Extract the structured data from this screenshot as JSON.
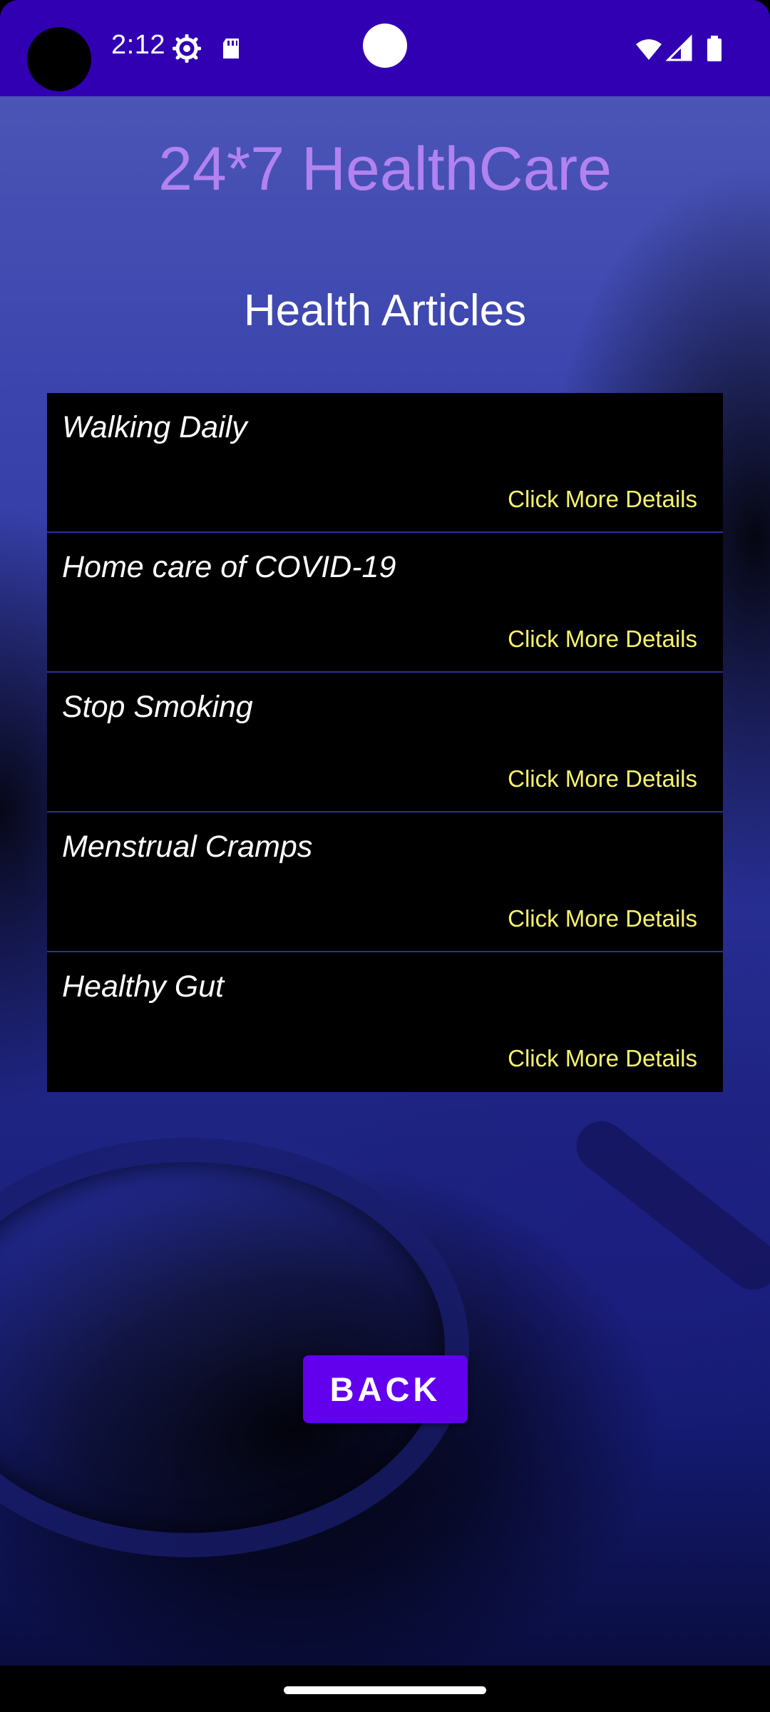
{
  "status_bar": {
    "time": "2:12",
    "icons": [
      "gear-icon",
      "sd-card-icon",
      "wifi-icon",
      "signal-icon",
      "battery-icon"
    ]
  },
  "app": {
    "title": "24*7 HealthCare",
    "page_title": "Health Articles"
  },
  "articles": [
    {
      "title": "Walking Daily",
      "link_label": "Click More Details"
    },
    {
      "title": "Home care of COVID-19",
      "link_label": "Click More Details"
    },
    {
      "title": "Stop Smoking",
      "link_label": "Click More Details"
    },
    {
      "title": "Menstrual Cramps",
      "link_label": "Click More Details"
    },
    {
      "title": "Healthy Gut",
      "link_label": "Click More Details"
    }
  ],
  "actions": {
    "back_label": "BACK"
  },
  "colors": {
    "status_bar": "#3100b3",
    "app_title": "#b283f0",
    "link": "#f6f36b",
    "button": "#6200ee"
  }
}
